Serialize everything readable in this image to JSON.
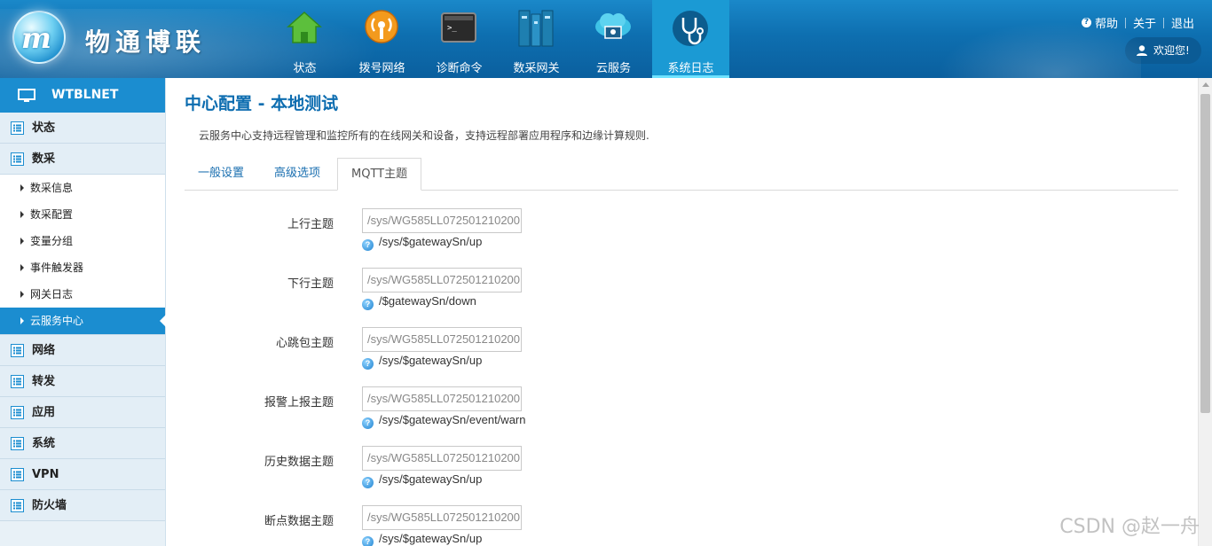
{
  "header": {
    "brand": "物通博联",
    "logo_text": "m",
    "nav": [
      {
        "label": "状态",
        "icon": "house-icon"
      },
      {
        "label": "拨号网络",
        "icon": "broadcast-icon"
      },
      {
        "label": "诊断命令",
        "icon": "terminal-icon"
      },
      {
        "label": "数采网关",
        "icon": "server-rack-icon"
      },
      {
        "label": "云服务",
        "icon": "cloud-monitor-icon"
      },
      {
        "label": "系统日志",
        "icon": "stethoscope-icon",
        "active": true
      }
    ],
    "help": "帮助",
    "about": "关于",
    "logout": "退出",
    "welcome": "欢迎您!"
  },
  "sidebar": {
    "title": "WTBLNET",
    "groups": [
      {
        "label": "状态"
      },
      {
        "label": "数采",
        "items": [
          {
            "label": "数采信息"
          },
          {
            "label": "数采配置"
          },
          {
            "label": "变量分组"
          },
          {
            "label": "事件触发器"
          },
          {
            "label": "网关日志"
          },
          {
            "label": "云服务中心",
            "active": true
          }
        ]
      },
      {
        "label": "网络"
      },
      {
        "label": "转发"
      },
      {
        "label": "应用"
      },
      {
        "label": "系统"
      },
      {
        "label": "VPN"
      },
      {
        "label": "防火墙"
      }
    ]
  },
  "main": {
    "title": "中心配置 - 本地测试",
    "description": "云服务中心支持远程管理和监控所有的在线网关和设备，支持远程部署应用程序和边缘计算规则.",
    "tabs": [
      {
        "label": "一般设置"
      },
      {
        "label": "高级选项"
      },
      {
        "label": "MQTT主题",
        "active": true
      }
    ],
    "fields": [
      {
        "label": "上行主题",
        "placeholder": "/sys/WG585LL072501210200",
        "hint": "/sys/$gatewaySn/up"
      },
      {
        "label": "下行主题",
        "placeholder": "/sys/WG585LL072501210200",
        "hint": "/$gatewaySn/down"
      },
      {
        "label": "心跳包主题",
        "placeholder": "/sys/WG585LL072501210200",
        "hint": "/sys/$gatewaySn/up"
      },
      {
        "label": "报警上报主题",
        "placeholder": "/sys/WG585LL072501210200",
        "hint": "/sys/$gatewaySn/event/warn"
      },
      {
        "label": "历史数据主题",
        "placeholder": "/sys/WG585LL072501210200",
        "hint": "/sys/$gatewaySn/up"
      },
      {
        "label": "断点数据主题",
        "placeholder": "/sys/WG585LL072501210200",
        "hint": "/sys/$gatewaySn/up"
      }
    ]
  },
  "watermark": "CSDN @赵一舟",
  "colors": {
    "header_blue": "#0e6fb0",
    "accent_blue": "#1b8dd0",
    "title_blue": "#0d6db0",
    "nav_active": "#1b9ad4"
  }
}
